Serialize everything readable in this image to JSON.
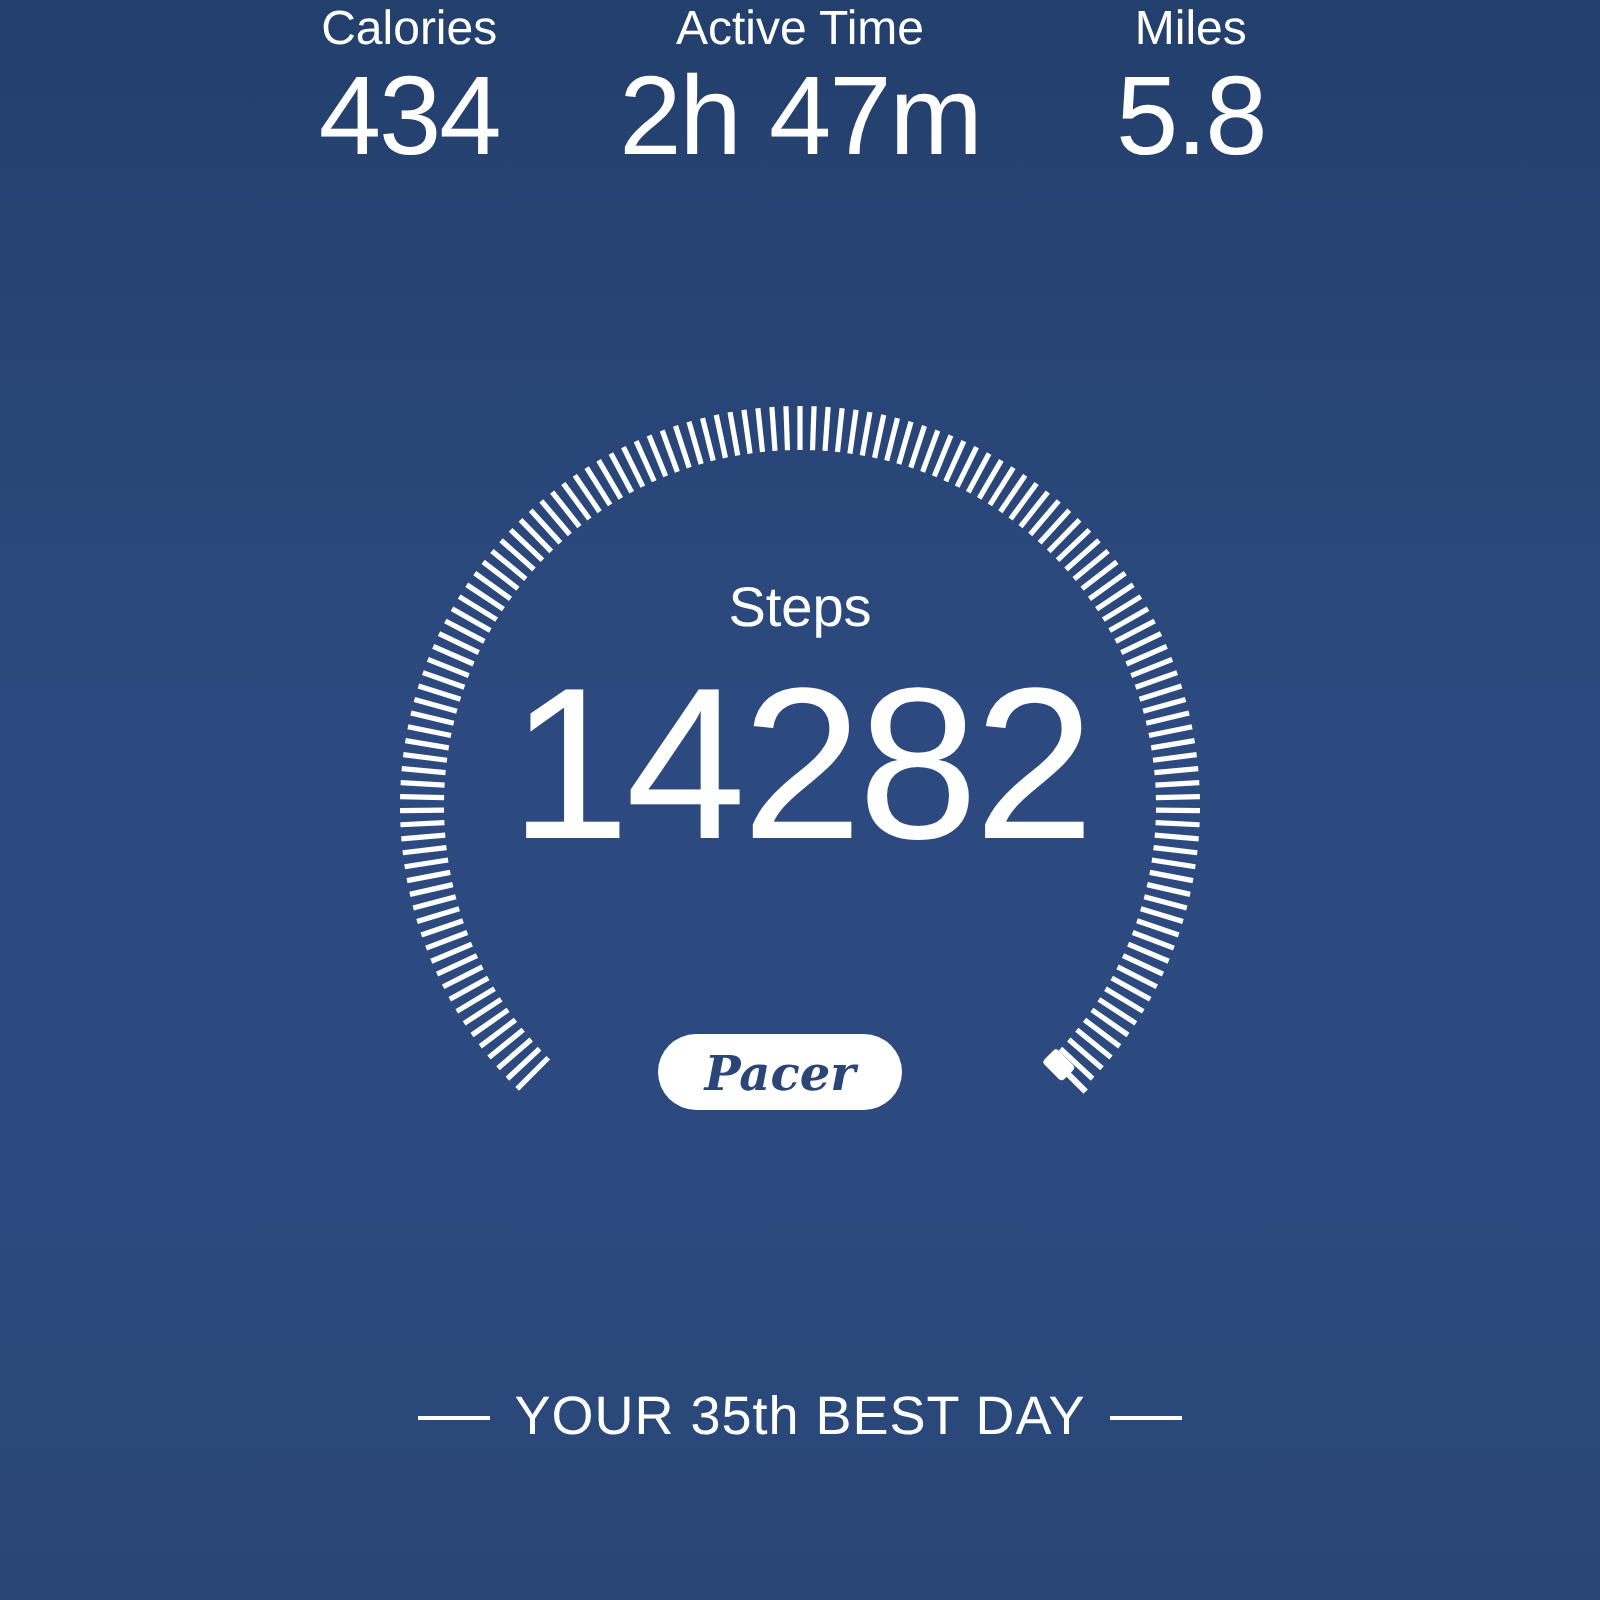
{
  "stats": [
    {
      "label": "Calories",
      "value": "434"
    },
    {
      "label": "Active Time",
      "value": "2h 47m"
    },
    {
      "label": "Miles",
      "value": "5.8"
    }
  ],
  "gauge": {
    "label": "Steps",
    "value": "14282"
  },
  "brand": "Pacer",
  "footer": "YOUR 35th BEST DAY"
}
